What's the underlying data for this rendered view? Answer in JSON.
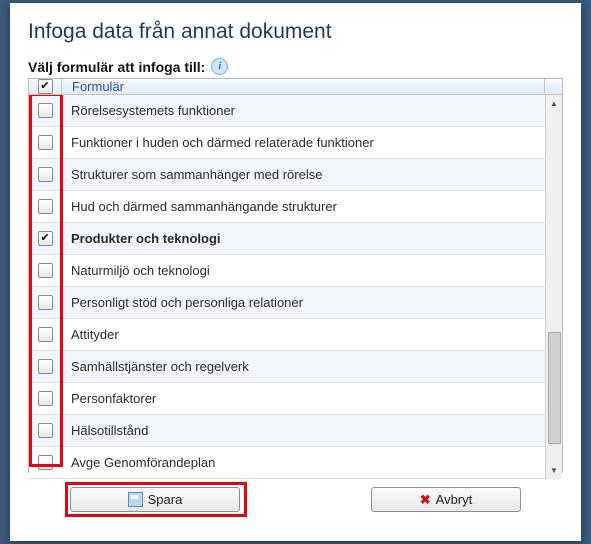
{
  "dialog": {
    "title": "Infoga data från annat dokument",
    "subtitle": "Välj formulär att infoga till:"
  },
  "header": {
    "column_label": "Formulär"
  },
  "rows": [
    {
      "label": "Rörelsesystemets funktioner",
      "checked": false
    },
    {
      "label": "Funktioner i huden och därmed relaterade funktioner",
      "checked": false
    },
    {
      "label": "Strukturer som sammanhänger med rörelse",
      "checked": false
    },
    {
      "label": "Hud och därmed sammanhängande strukturer",
      "checked": false
    },
    {
      "label": "Produkter och teknologi",
      "checked": true
    },
    {
      "label": "Naturmiljö och teknologi",
      "checked": false
    },
    {
      "label": "Personligt stöd och personliga relationer",
      "checked": false
    },
    {
      "label": "Attityder",
      "checked": false
    },
    {
      "label": "Samhällstjänster och regelverk",
      "checked": false
    },
    {
      "label": "Personfaktorer",
      "checked": false
    },
    {
      "label": "Hälsotillstånd",
      "checked": false
    },
    {
      "label": "Avge Genomförandeplan",
      "checked": false
    }
  ],
  "buttons": {
    "save": "Spara",
    "cancel": "Avbryt"
  }
}
